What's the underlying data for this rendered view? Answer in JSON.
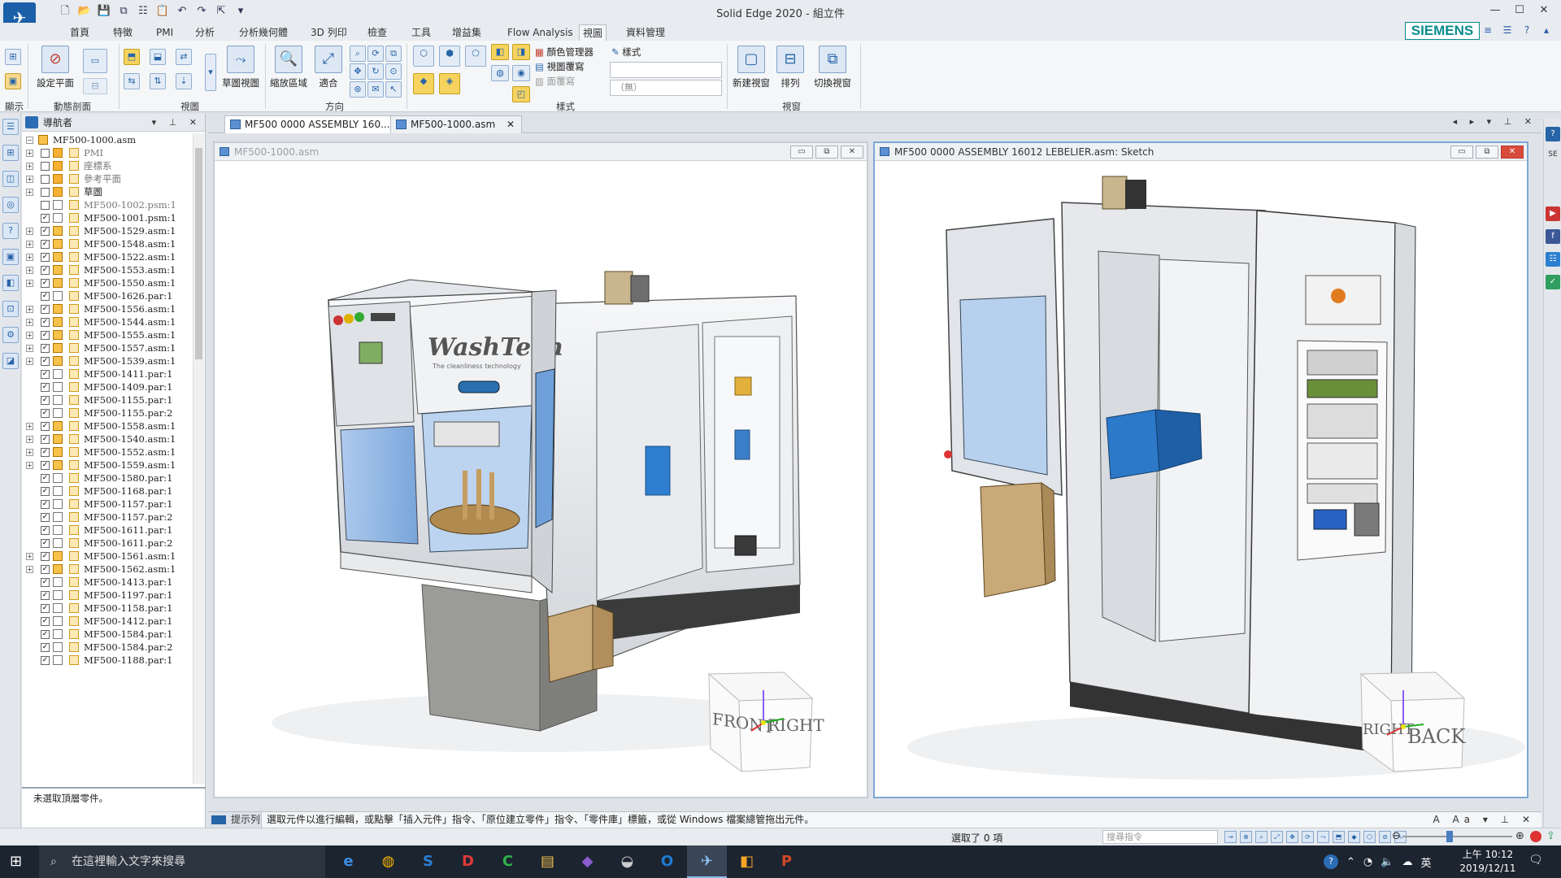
{
  "app": {
    "title": "Solid Edge 2020 - 組立件",
    "brand": "SIEMENS",
    "accent_color": "#1a5fa8",
    "brand_color": "#0a8c8c"
  },
  "menu": {
    "tabs": [
      "首頁",
      "特徵",
      "PMI",
      "分析",
      "分析幾何體",
      "3D 列印",
      "檢查",
      "工具",
      "增益集",
      "Flow Analysis",
      "視圖",
      "資料管理"
    ],
    "active": "視圖"
  },
  "ribbon": {
    "display_group": "顯示",
    "set_plane": "設定平面",
    "dynamic_section_group": "動態剖面",
    "view_group": "視圖",
    "sketch_view": "草圖視圖",
    "zoom_area": "縮放區域",
    "fit": "適合",
    "orient_group": "方向",
    "color_manager": "顏色管理器",
    "view_override": "視圖覆寫",
    "face_override": "面覆寫",
    "style_label": "樣式",
    "style_value": "（無）",
    "style_group": "樣式",
    "new_window": "新建視窗",
    "arrange": "排列",
    "switch_window": "切換視窗",
    "window_group": "視窗"
  },
  "navigator": {
    "title": "導航者",
    "root": "MF500-1000.asm",
    "items": [
      {
        "label": "PMI",
        "checked": false,
        "expand": true,
        "kind": "pmi",
        "gray": true
      },
      {
        "label": "座標系",
        "checked": false,
        "expand": true,
        "kind": "coord",
        "gray": true
      },
      {
        "label": "參考平面",
        "checked": false,
        "expand": true,
        "kind": "plane",
        "gray": true
      },
      {
        "label": "草圖",
        "checked": false,
        "expand": true,
        "kind": "sketch",
        "gray": false
      },
      {
        "label": "MF500-1002.psm:1",
        "checked": false,
        "expand": false,
        "kind": "part",
        "gray": true
      },
      {
        "label": "MF500-1001.psm:1",
        "checked": true,
        "expand": false,
        "kind": "part",
        "gray": false
      },
      {
        "label": "MF500-1529.asm:1",
        "checked": true,
        "expand": true,
        "kind": "asm",
        "gray": false
      },
      {
        "label": "MF500-1548.asm:1",
        "checked": true,
        "expand": true,
        "kind": "asm",
        "gray": false
      },
      {
        "label": "MF500-1522.asm:1",
        "checked": true,
        "expand": true,
        "kind": "asm",
        "gray": false
      },
      {
        "label": "MF500-1553.asm:1",
        "checked": true,
        "expand": true,
        "kind": "asm",
        "gray": false
      },
      {
        "label": "MF500-1550.asm:1",
        "checked": true,
        "expand": true,
        "kind": "asm",
        "gray": false
      },
      {
        "label": "MF500-1626.par:1",
        "checked": true,
        "expand": false,
        "kind": "part",
        "gray": false
      },
      {
        "label": "MF500-1556.asm:1",
        "checked": true,
        "expand": true,
        "kind": "asm",
        "gray": false
      },
      {
        "label": "MF500-1544.asm:1",
        "checked": true,
        "expand": true,
        "kind": "asm",
        "gray": false
      },
      {
        "label": "MF500-1555.asm:1",
        "checked": true,
        "expand": true,
        "kind": "asm",
        "gray": false
      },
      {
        "label": "MF500-1557.asm:1",
        "checked": true,
        "expand": true,
        "kind": "asm",
        "gray": false
      },
      {
        "label": "MF500-1539.asm:1",
        "checked": true,
        "expand": true,
        "kind": "asm",
        "gray": false
      },
      {
        "label": "MF500-1411.par:1",
        "checked": true,
        "expand": false,
        "kind": "part",
        "gray": false
      },
      {
        "label": "MF500-1409.par:1",
        "checked": true,
        "expand": false,
        "kind": "part",
        "gray": false
      },
      {
        "label": "MF500-1155.par:1",
        "checked": true,
        "expand": false,
        "kind": "part",
        "gray": false
      },
      {
        "label": "MF500-1155.par:2",
        "checked": true,
        "expand": false,
        "kind": "part",
        "gray": false
      },
      {
        "label": "MF500-1558.asm:1",
        "checked": true,
        "expand": true,
        "kind": "asm",
        "gray": false
      },
      {
        "label": "MF500-1540.asm:1",
        "checked": true,
        "expand": true,
        "kind": "asm",
        "gray": false
      },
      {
        "label": "MF500-1552.asm:1",
        "checked": true,
        "expand": true,
        "kind": "asm",
        "gray": false
      },
      {
        "label": "MF500-1559.asm:1",
        "checked": true,
        "expand": true,
        "kind": "asm",
        "gray": false
      },
      {
        "label": "MF500-1580.par:1",
        "checked": true,
        "expand": false,
        "kind": "part",
        "gray": false
      },
      {
        "label": "MF500-1168.par:1",
        "checked": true,
        "expand": false,
        "kind": "part",
        "gray": false
      },
      {
        "label": "MF500-1157.par:1",
        "checked": true,
        "expand": false,
        "kind": "part",
        "gray": false
      },
      {
        "label": "MF500-1157.par:2",
        "checked": true,
        "expand": false,
        "kind": "part",
        "gray": false
      },
      {
        "label": "MF500-1611.par:1",
        "checked": true,
        "expand": false,
        "kind": "part",
        "gray": false
      },
      {
        "label": "MF500-1611.par:2",
        "checked": true,
        "expand": false,
        "kind": "part",
        "gray": false
      },
      {
        "label": "MF500-1561.asm:1",
        "checked": true,
        "expand": true,
        "kind": "asm",
        "gray": false
      },
      {
        "label": "MF500-1562.asm:1",
        "checked": true,
        "expand": true,
        "kind": "asm",
        "gray": false
      },
      {
        "label": "MF500-1413.par:1",
        "checked": true,
        "expand": false,
        "kind": "part",
        "gray": false
      },
      {
        "label": "MF500-1197.par:1",
        "checked": true,
        "expand": false,
        "kind": "part",
        "gray": false
      },
      {
        "label": "MF500-1158.par:1",
        "checked": true,
        "expand": false,
        "kind": "part",
        "gray": false
      },
      {
        "label": "MF500-1412.par:1",
        "checked": true,
        "expand": false,
        "kind": "part",
        "gray": false
      },
      {
        "label": "MF500-1584.par:1",
        "checked": true,
        "expand": false,
        "kind": "part",
        "gray": false
      },
      {
        "label": "MF500-1584.par:2",
        "checked": true,
        "expand": false,
        "kind": "part",
        "gray": false
      },
      {
        "label": "MF500-1188.par:1",
        "checked": true,
        "expand": false,
        "kind": "part",
        "gray": false
      }
    ],
    "footer": "未選取頂層零件。"
  },
  "documents": {
    "tabs": [
      {
        "label": "MF500 0000 ASSEMBLY 160...",
        "active": true
      },
      {
        "label": "MF500-1000.asm",
        "active": false
      }
    ]
  },
  "viewports": {
    "left": {
      "title": "MF500-1000.asm",
      "logo_text": "WashTech",
      "logo_tagline": "The cleanliness technology",
      "cube_front": "FRONT",
      "cube_right": "RIGHT"
    },
    "right": {
      "title": "MF500 0000 ASSEMBLY 16012 LEBELIER.asm: Sketch",
      "cube_right": "RIGHT",
      "cube_back": "BACK"
    }
  },
  "prompt": {
    "label": "提示列",
    "text": "選取元件以進行編輯，或點擊「插入元件」指令、「原位建立零件」指令、「零件庫」標籤，或從 Windows 檔案總管拖出元件。"
  },
  "status": {
    "selection": "選取了 0 項",
    "search_placeholder": "搜尋指令"
  },
  "taskbar": {
    "search_placeholder": "在這裡輸入文字來搜尋",
    "apps": [
      "edge",
      "chrome",
      "swiftkey",
      "reader",
      "camtasia",
      "file-explorer",
      "visual-studio",
      "fish",
      "outlook",
      "solid-edge",
      "sandbox",
      "powerpoint"
    ],
    "ime": "英",
    "time": "上午 10:12",
    "date": "2019/12/11"
  }
}
